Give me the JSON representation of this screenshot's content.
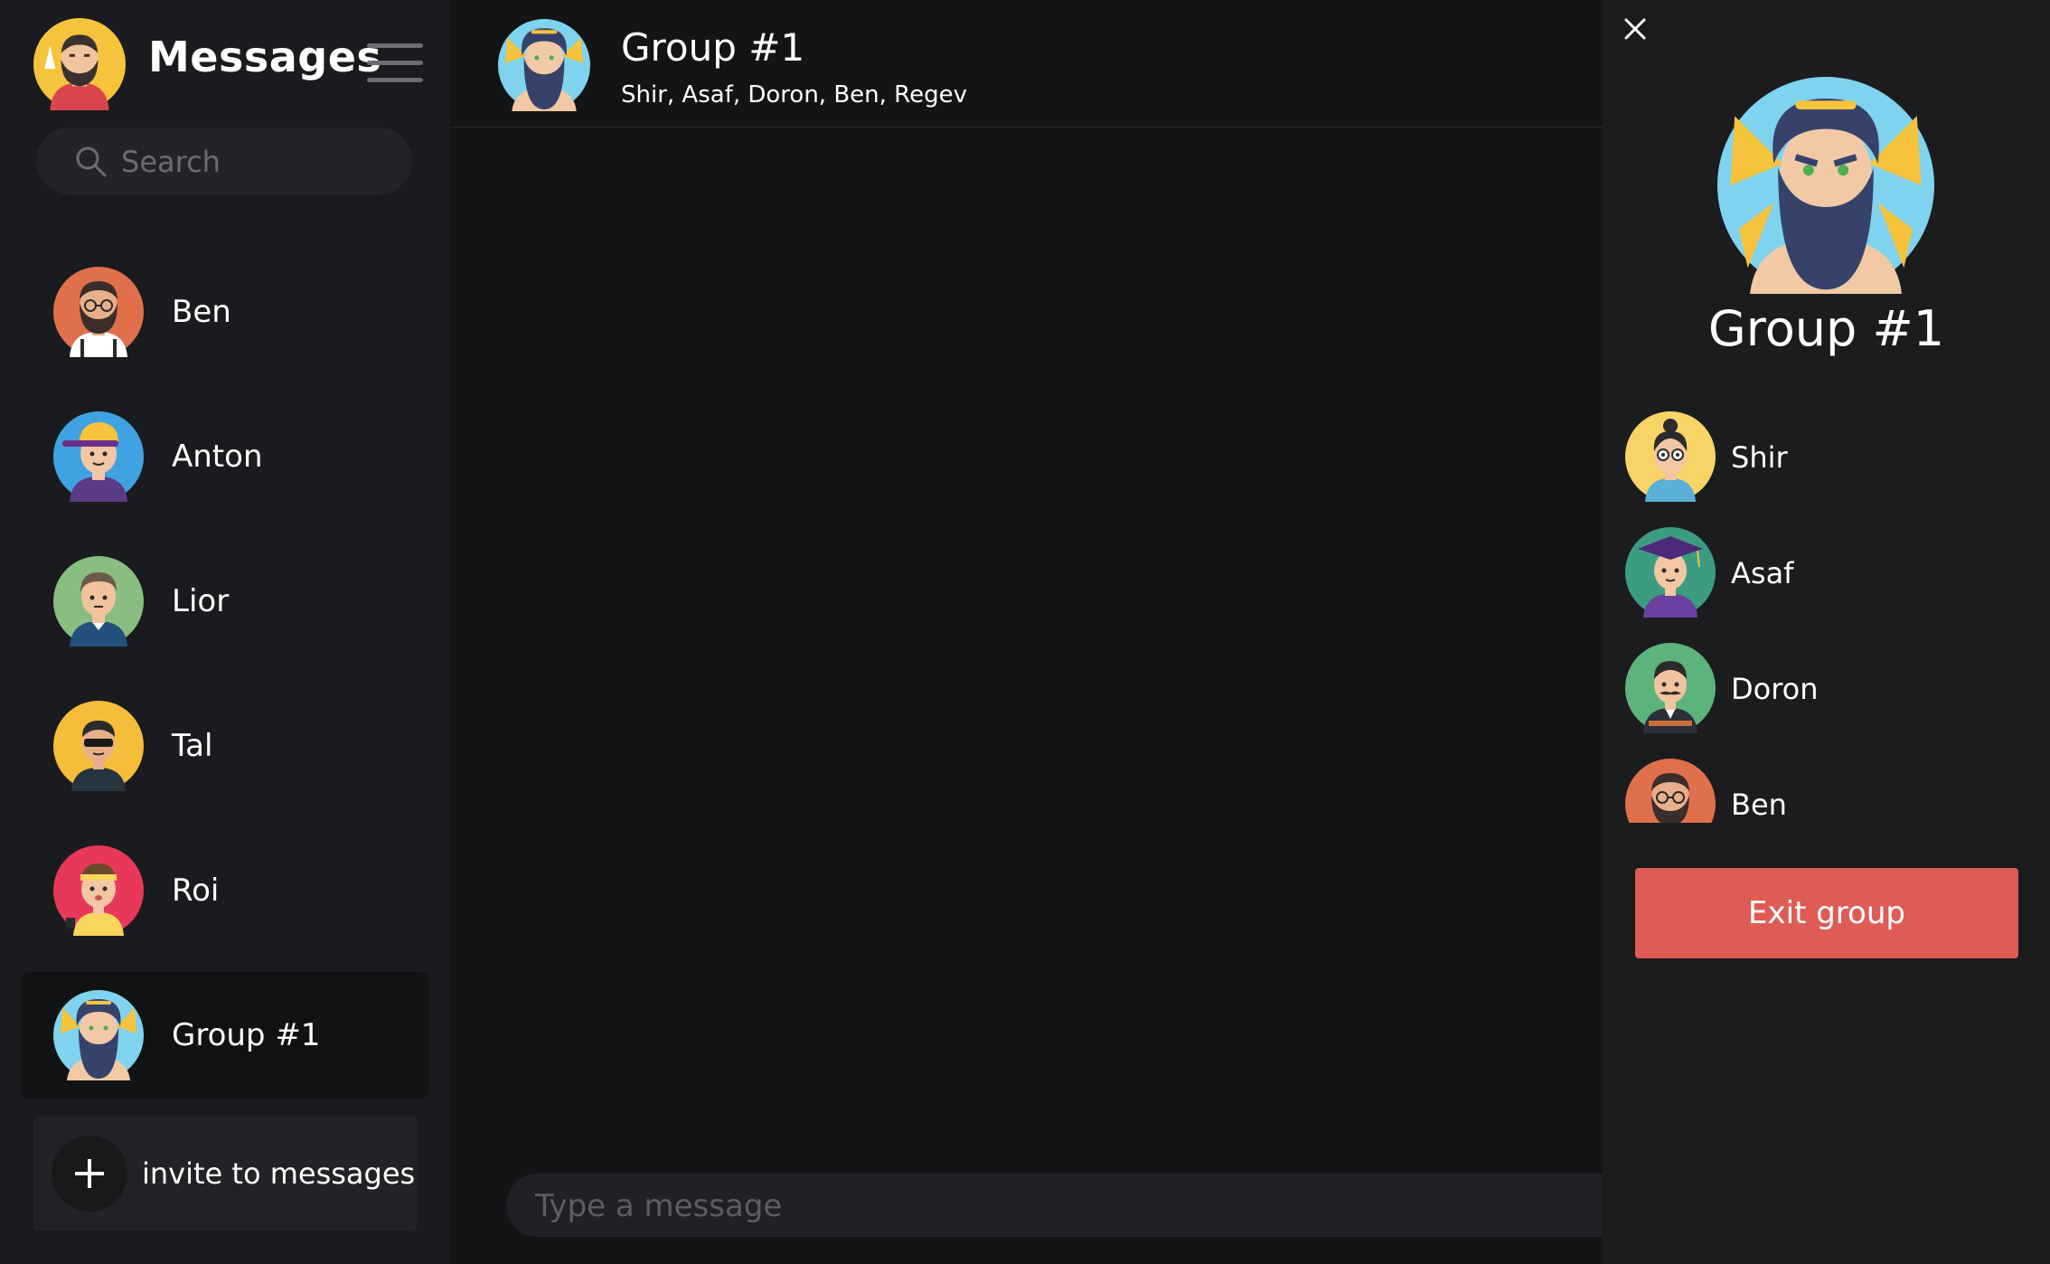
{
  "sidebar": {
    "title": "Messages",
    "search": {
      "placeholder": "Search",
      "value": ""
    },
    "contacts": [
      {
        "name": "Ben",
        "avatar_bg": "#e0704b"
      },
      {
        "name": "Anton",
        "avatar_bg": "#3fa3e2"
      },
      {
        "name": "Lior",
        "avatar_bg": "#89bd82"
      },
      {
        "name": "Tal",
        "avatar_bg": "#f5bd3a"
      },
      {
        "name": "Roi",
        "avatar_bg": "#e8385a"
      },
      {
        "name": "Group #1",
        "avatar_bg": "#7fd3ee",
        "selected": true
      }
    ],
    "invite_label": "invite to messages"
  },
  "chat": {
    "title": "Group #1",
    "members_line": "Shir, Asaf, Doron, Ben, Regev",
    "composer_placeholder": "Type a message"
  },
  "details": {
    "title": "Group #1",
    "members": [
      {
        "name": "Shir",
        "avatar_bg": "#f8d466"
      },
      {
        "name": "Asaf",
        "avatar_bg": "#3c9c82"
      },
      {
        "name": "Doron",
        "avatar_bg": "#5cb37c"
      },
      {
        "name": "Ben",
        "avatar_bg": "#e0704b"
      }
    ],
    "exit_label": "Exit group"
  },
  "colors": {
    "accent_red": "#de5b56",
    "sidebar_bg": "#1a1b1e",
    "chat_bg": "#131416",
    "panel_bg": "#1b1c1e"
  }
}
